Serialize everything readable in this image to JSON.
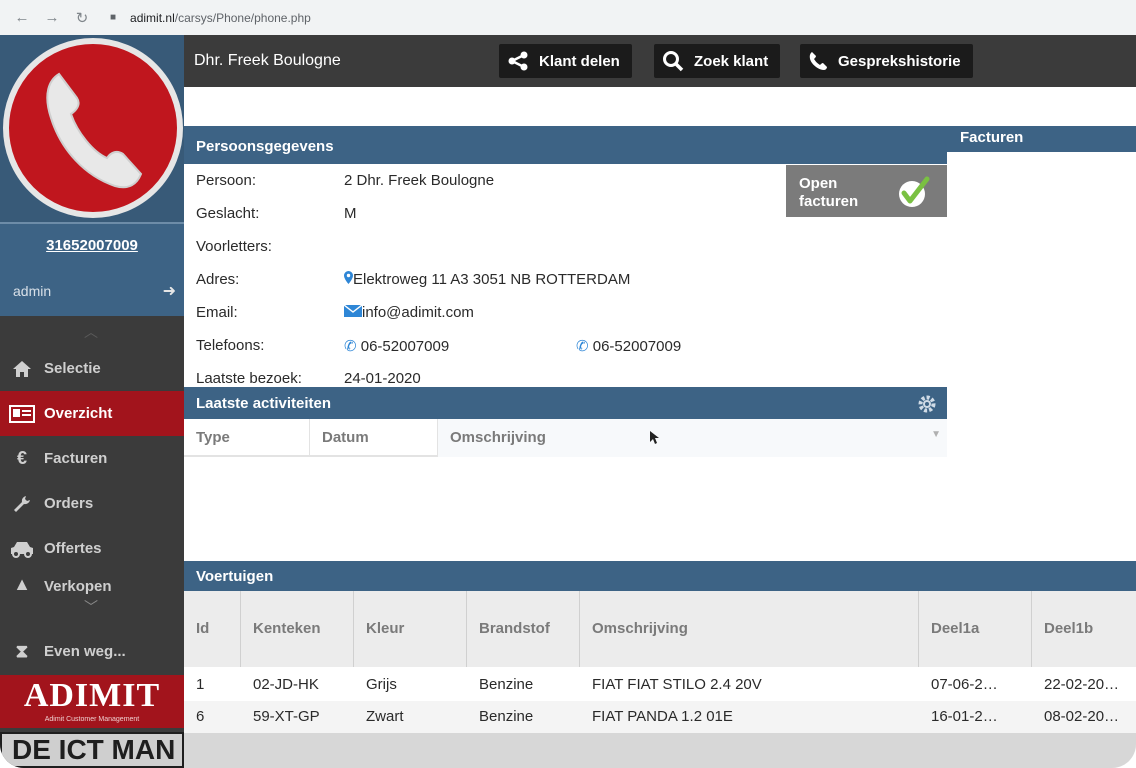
{
  "browser": {
    "url_host": "adimit.nl",
    "url_path": "/carsys/Phone/phone.php"
  },
  "sidebar": {
    "phone_number": "31652007009",
    "user": "admin",
    "items": [
      {
        "label": "Selectie",
        "icon": "home-icon"
      },
      {
        "label": "Overzicht",
        "icon": "id-card-icon"
      },
      {
        "label": "Facturen",
        "icon": "euro-icon"
      },
      {
        "label": "Orders",
        "icon": "wrench-icon"
      },
      {
        "label": "Offertes",
        "icon": "car-icon"
      },
      {
        "label": "Verkopen",
        "icon": "tag-icon"
      }
    ],
    "away_label": "Even weg...",
    "logo_text": "ADIMIT",
    "logo_subtext": "Adimit Customer Management",
    "logo_banner": "DE ICT MAN"
  },
  "topbar": {
    "customer_name": "Dhr. Freek Boulogne",
    "buttons": [
      "Klant delen",
      "Zoek klant",
      "Gesprekshistorie"
    ]
  },
  "persoonsgegevens": {
    "title": "Persoonsgegevens",
    "fields": [
      {
        "label": "Persoon:",
        "value": "2 Dhr. Freek Boulogne"
      },
      {
        "label": "Geslacht:",
        "value": "M"
      },
      {
        "label": "Voorletters:",
        "value": ""
      },
      {
        "label": "Adres:",
        "value": "Elektroweg 11 A3 3051 NB ROTTERDAM"
      },
      {
        "label": "Email:",
        "value": "info@adimit.com"
      },
      {
        "label": "Telefoons:",
        "value": "06-52007009",
        "value2": "06-52007009"
      },
      {
        "label": "Laatste bezoek:",
        "value": "24-01-2020"
      }
    ],
    "open_facturen": [
      "Open",
      "facturen"
    ]
  },
  "facturen": {
    "title": "Facturen"
  },
  "activiteiten": {
    "title": "Laatste activiteiten",
    "columns": [
      "Type",
      "Datum",
      "Omschrijving"
    ]
  },
  "voertuigen": {
    "title": "Voertuigen",
    "columns": [
      "Id",
      "Kenteken",
      "Kleur",
      "Brandstof",
      "Omschrijving",
      "Deel1a",
      "Deel1b"
    ],
    "rows": [
      [
        "1",
        "02-JD-HK",
        "Grijs",
        "Benzine",
        "FIAT FIAT STILO 2.4 20V",
        "07-06-2…",
        "22-02-20…"
      ],
      [
        "6",
        "59-XT-GP",
        "Zwart",
        "Benzine",
        "FIAT PANDA 1.2 01E",
        "16-01-2…",
        "08-02-20…"
      ]
    ]
  },
  "colors": {
    "header_blue": "#3d6385",
    "active_red": "#a2141c",
    "sidebar_dark": "#3b3b3b",
    "icon_blue": "#2e86d6",
    "check_green": "#7ac142"
  }
}
